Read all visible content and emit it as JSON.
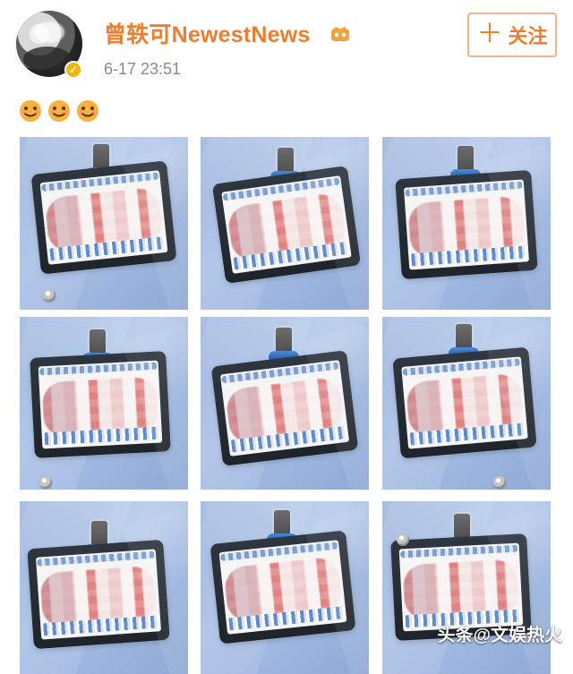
{
  "post": {
    "username": "曾轶可NewestNews",
    "time": "6-17 23:51",
    "follow_label": "关注",
    "follow_icon": "plus-icon",
    "verified_icon": "verified-badge-icon",
    "badge_icon": "tv-badge-icon"
  },
  "content": {
    "emoji_count": 3,
    "emoji_name": "smiling-face-emoji"
  },
  "grid": {
    "photos": [
      {
        "label": "photo-1"
      },
      {
        "label": "photo-2"
      },
      {
        "label": "photo-3"
      },
      {
        "label": "photo-4"
      },
      {
        "label": "photo-5"
      },
      {
        "label": "photo-6"
      },
      {
        "label": "photo-7"
      },
      {
        "label": "photo-8"
      },
      {
        "label": "photo-9"
      }
    ]
  },
  "watermark": {
    "text": "头条@文娱热火"
  },
  "colors": {
    "accent": "#ef7d2d",
    "button_border": "#f2b28c",
    "time": "#8a8a8a"
  }
}
